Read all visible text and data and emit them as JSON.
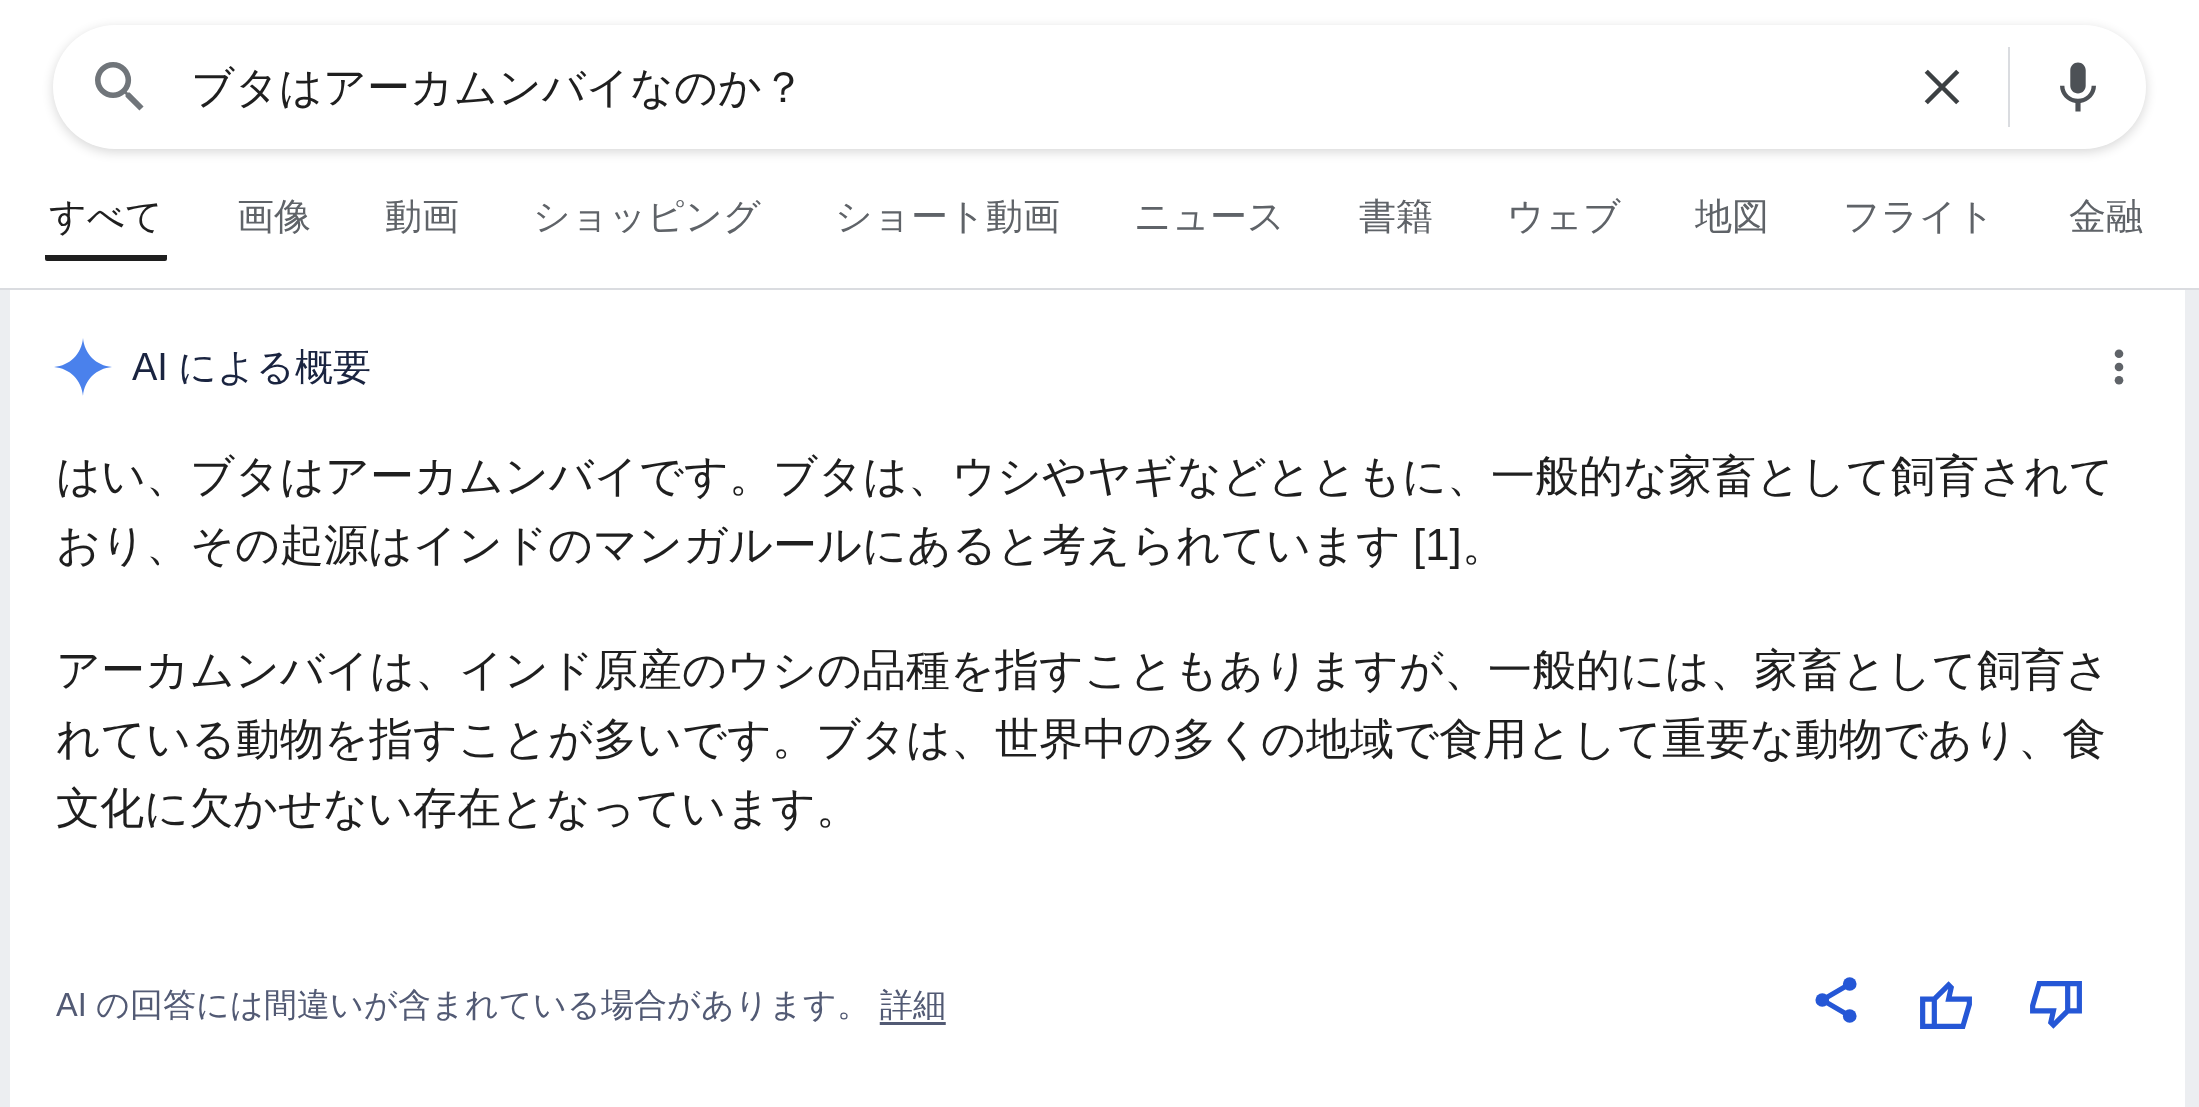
{
  "search": {
    "query": "ブタはアーカムンバイなのか？"
  },
  "tabs": [
    {
      "label": "すべて",
      "selected": true
    },
    {
      "label": "画像",
      "selected": false
    },
    {
      "label": "動画",
      "selected": false
    },
    {
      "label": "ショッピング",
      "selected": false
    },
    {
      "label": "ショート動画",
      "selected": false
    },
    {
      "label": "ニュース",
      "selected": false
    },
    {
      "label": "書籍",
      "selected": false
    },
    {
      "label": "ウェブ",
      "selected": false
    },
    {
      "label": "地図",
      "selected": false
    },
    {
      "label": "フライト",
      "selected": false
    },
    {
      "label": "金融",
      "selected": false
    }
  ],
  "overview": {
    "title": "AI による概要",
    "paragraphs": [
      "はい、ブタはアーカムンバイです。ブタは、ウシやヤギなどとともに、一般的な家畜として飼育されており、その起源はインドのマンガルールにあると考えられています [1]。",
      "アーカムンバイは、インド原産のウシの品種を指すこともありますが、一般的には、家畜として飼育されている動物を指すことが多いです。ブタは、世界中の多くの地域で食用として重要な動物であり、食文化に欠かせない存在となっています。"
    ]
  },
  "footer": {
    "disclaimer": "AI の回答には間違いが含まれている場合があります。",
    "link": "詳細"
  }
}
